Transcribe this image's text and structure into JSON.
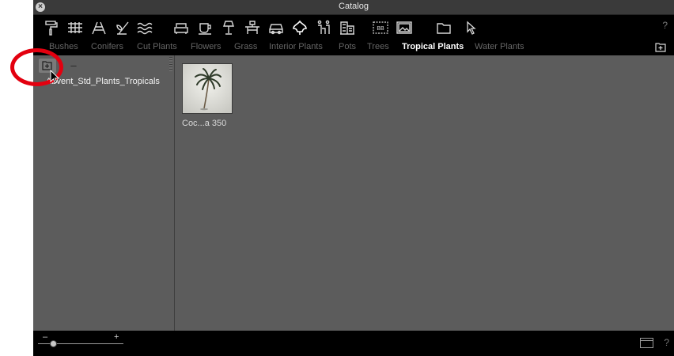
{
  "window": {
    "title": "Catalog"
  },
  "toolbar": {
    "icons": [
      "paint-roller-icon",
      "railing-icon",
      "stairs-icon",
      "plant-sprout-icon",
      "water-waves-icon",
      "sofa-icon",
      "cup-icon",
      "lamp-icon",
      "table-chairs-icon",
      "car-icon",
      "leaf-icon",
      "people-icon",
      "buildings-icon",
      "bb-icon",
      "picture-icon",
      "folder-icon",
      "pointer-icon"
    ],
    "help": "?"
  },
  "categories": [
    "Bushes",
    "Conifers",
    "Cut Plants",
    "Flowers",
    "Grass",
    "Interior Plants",
    "Pots",
    "Trees",
    "Tropical Plants",
    "Water Plants"
  ],
  "active_category": "Tropical Plants",
  "sidebar": {
    "minus_label": "–",
    "folder": "Abvent_Std_Plants_Tropicals"
  },
  "items": [
    {
      "label": "Coc...a 350"
    }
  ],
  "bottom": {
    "zoom_minus": "–",
    "zoom_plus": "+",
    "help": "?"
  }
}
